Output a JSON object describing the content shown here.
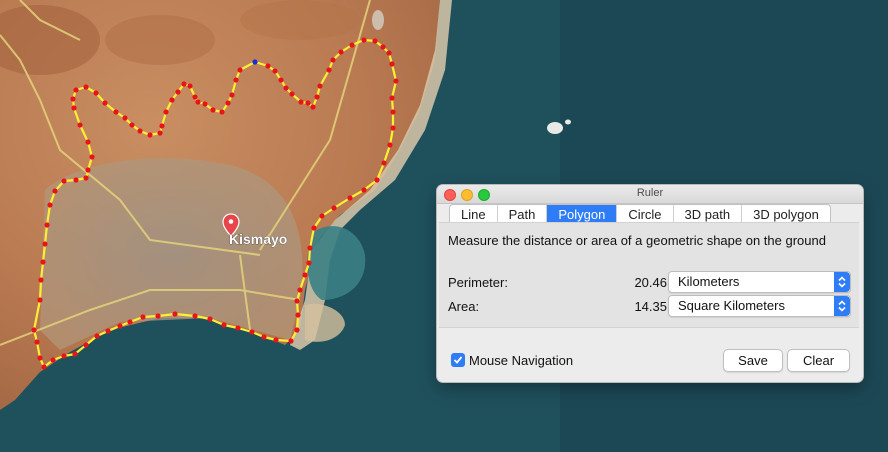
{
  "map": {
    "place_label": "Kismayo"
  },
  "ruler": {
    "window_title": "Ruler",
    "tabs": [
      {
        "label": "Line",
        "active": false
      },
      {
        "label": "Path",
        "active": false
      },
      {
        "label": "Polygon",
        "active": true
      },
      {
        "label": "Circle",
        "active": false
      },
      {
        "label": "3D path",
        "active": false
      },
      {
        "label": "3D polygon",
        "active": false
      }
    ],
    "description": "Measure the distance or area of a geometric shape on the ground",
    "perimeter": {
      "label": "Perimeter:",
      "value": "20.46",
      "unit": "Kilometers"
    },
    "area": {
      "label": "Area:",
      "value": "14.35",
      "unit": "Square Kilometers"
    },
    "mouse_navigation": {
      "label": "Mouse Navigation",
      "checked": true
    },
    "save_label": "Save",
    "clear_label": "Clear"
  },
  "colors": {
    "accent": "#2f7df6",
    "polygon_line": "#ffee33",
    "vertex": "#e8141b",
    "selected_vertex": "#1a2dd6"
  }
}
